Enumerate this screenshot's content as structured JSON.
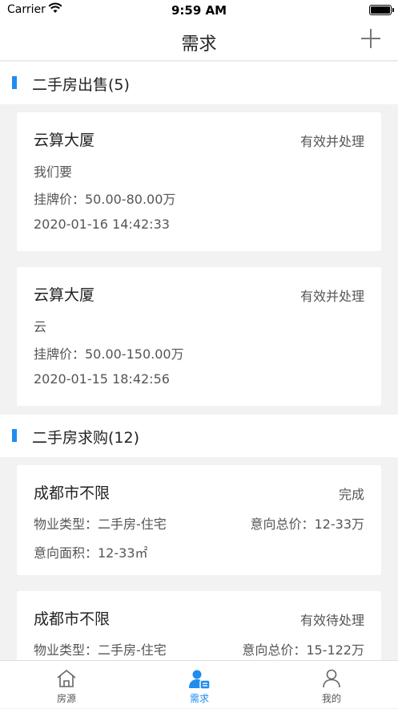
{
  "status": {
    "carrier": "Carrier",
    "time": "9:59 AM"
  },
  "nav": {
    "title": "需求"
  },
  "sections": [
    {
      "title": "二手房出售(5)"
    },
    {
      "title": "二手房求购(12)"
    }
  ],
  "sale_cards": [
    {
      "title": "云算大厦",
      "status": "有效并处理",
      "desc": "我们要",
      "price": "挂牌价：50.00-80.00万",
      "time": "2020-01-16 14:42:33"
    },
    {
      "title": "云算大厦",
      "status": "有效并处理",
      "desc": "云",
      "price": "挂牌价：50.00-150.00万",
      "time": "2020-01-15 18:42:56"
    }
  ],
  "buy_cards": [
    {
      "title": "成都市不限",
      "status": "完成",
      "type": "物业类型：二手房-住宅",
      "total": "意向总价：12-33万",
      "area": "意向面积：12-33㎡"
    },
    {
      "title": "成都市不限",
      "status": "有效待处理",
      "type": "物业类型：二手房-住宅",
      "total": "意向总价：15-122万",
      "area": ""
    }
  ],
  "tabs": [
    {
      "label": "房源",
      "icon": "house-icon",
      "active": false
    },
    {
      "label": "需求",
      "icon": "demand-icon",
      "active": true
    },
    {
      "label": "我的",
      "icon": "person-icon",
      "active": false
    }
  ],
  "colors": {
    "accent": "#1f8cf0",
    "background": "#f2f2f2"
  }
}
